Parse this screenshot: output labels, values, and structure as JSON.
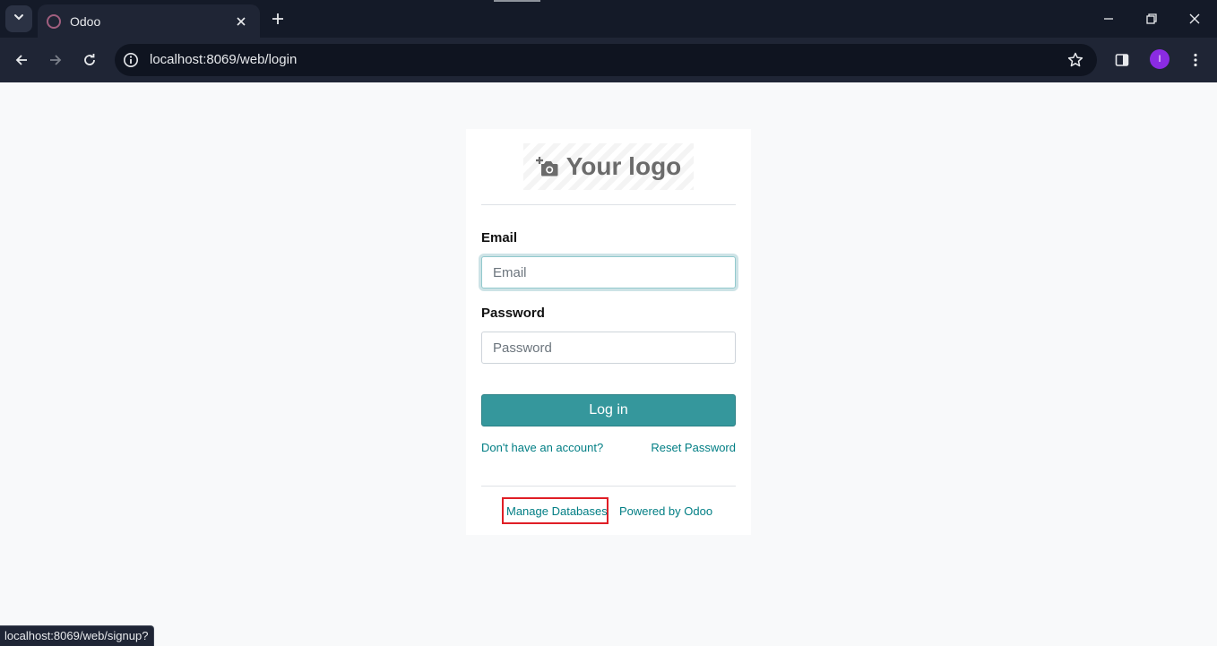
{
  "browser": {
    "tab": {
      "title": "Odoo"
    },
    "address_bar": {
      "url": "localhost:8069/web/login"
    },
    "profile": {
      "initial": "I",
      "color": "#8a2be2"
    }
  },
  "login": {
    "logo_text": "Your logo",
    "email": {
      "label": "Email",
      "placeholder": "Email",
      "value": ""
    },
    "password": {
      "label": "Password",
      "placeholder": "Password",
      "value": ""
    },
    "login_button": "Log in",
    "signup_link": "Don't have an account?",
    "reset_link": "Reset Password",
    "manage_databases_link": "Manage Databases",
    "powered_by_link": "Powered by Odoo",
    "accent_color": "#35979c",
    "link_color": "#017e84",
    "highlight_color": "#e01e26"
  },
  "status_bar": {
    "text": "localhost:8069/web/signup?"
  }
}
